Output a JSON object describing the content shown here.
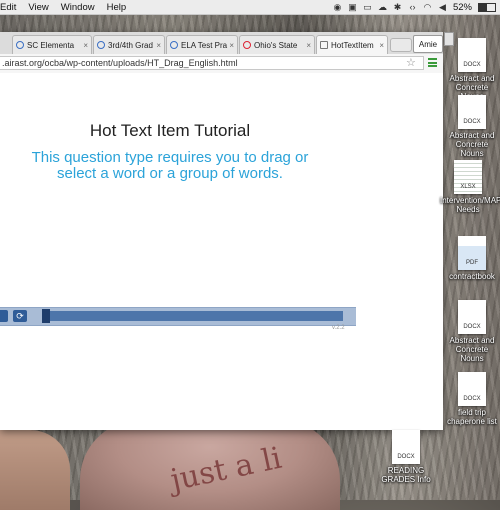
{
  "menubar": {
    "items": [
      "Edit",
      "View",
      "Window",
      "Help"
    ],
    "battery_percent": "52%"
  },
  "browser": {
    "tabs": [
      {
        "label": "SC Elementa",
        "icon": "globe-icon"
      },
      {
        "label": "3rd/4th Grad",
        "icon": "globe-icon"
      },
      {
        "label": "ELA Test Pra",
        "icon": "globe-icon"
      },
      {
        "label": "Ohio's State",
        "icon": "circle-icon"
      },
      {
        "label": "HotTextItem",
        "icon": "document-icon"
      }
    ],
    "profile": "Amie",
    "url": ".airast.org/ocba/wp-content/uploads/HT_Drag_English.html"
  },
  "page": {
    "title": "Hot Text  Item Tutorial",
    "subtitle": "This question type requires you to drag or select a word or a group of words.",
    "version": "v.2.2"
  },
  "desktop": {
    "icons": [
      {
        "label": "Abstract and Concrete Nouns",
        "type": "DOCX"
      },
      {
        "label": "Abstract and Concrete Nouns",
        "type": "DOCX"
      },
      {
        "label": "Intervention/MAP Needs",
        "type": "XLSX"
      },
      {
        "label": "contractbook",
        "type": "PDF"
      },
      {
        "label": "Abstract and Concrete Nouns",
        "type": "DOCX"
      },
      {
        "label": "field trip chaperone list",
        "type": "DOCX"
      },
      {
        "label": "READING GRADES  Info",
        "type": "DOCX"
      }
    ],
    "shirt_text": "just a li"
  }
}
